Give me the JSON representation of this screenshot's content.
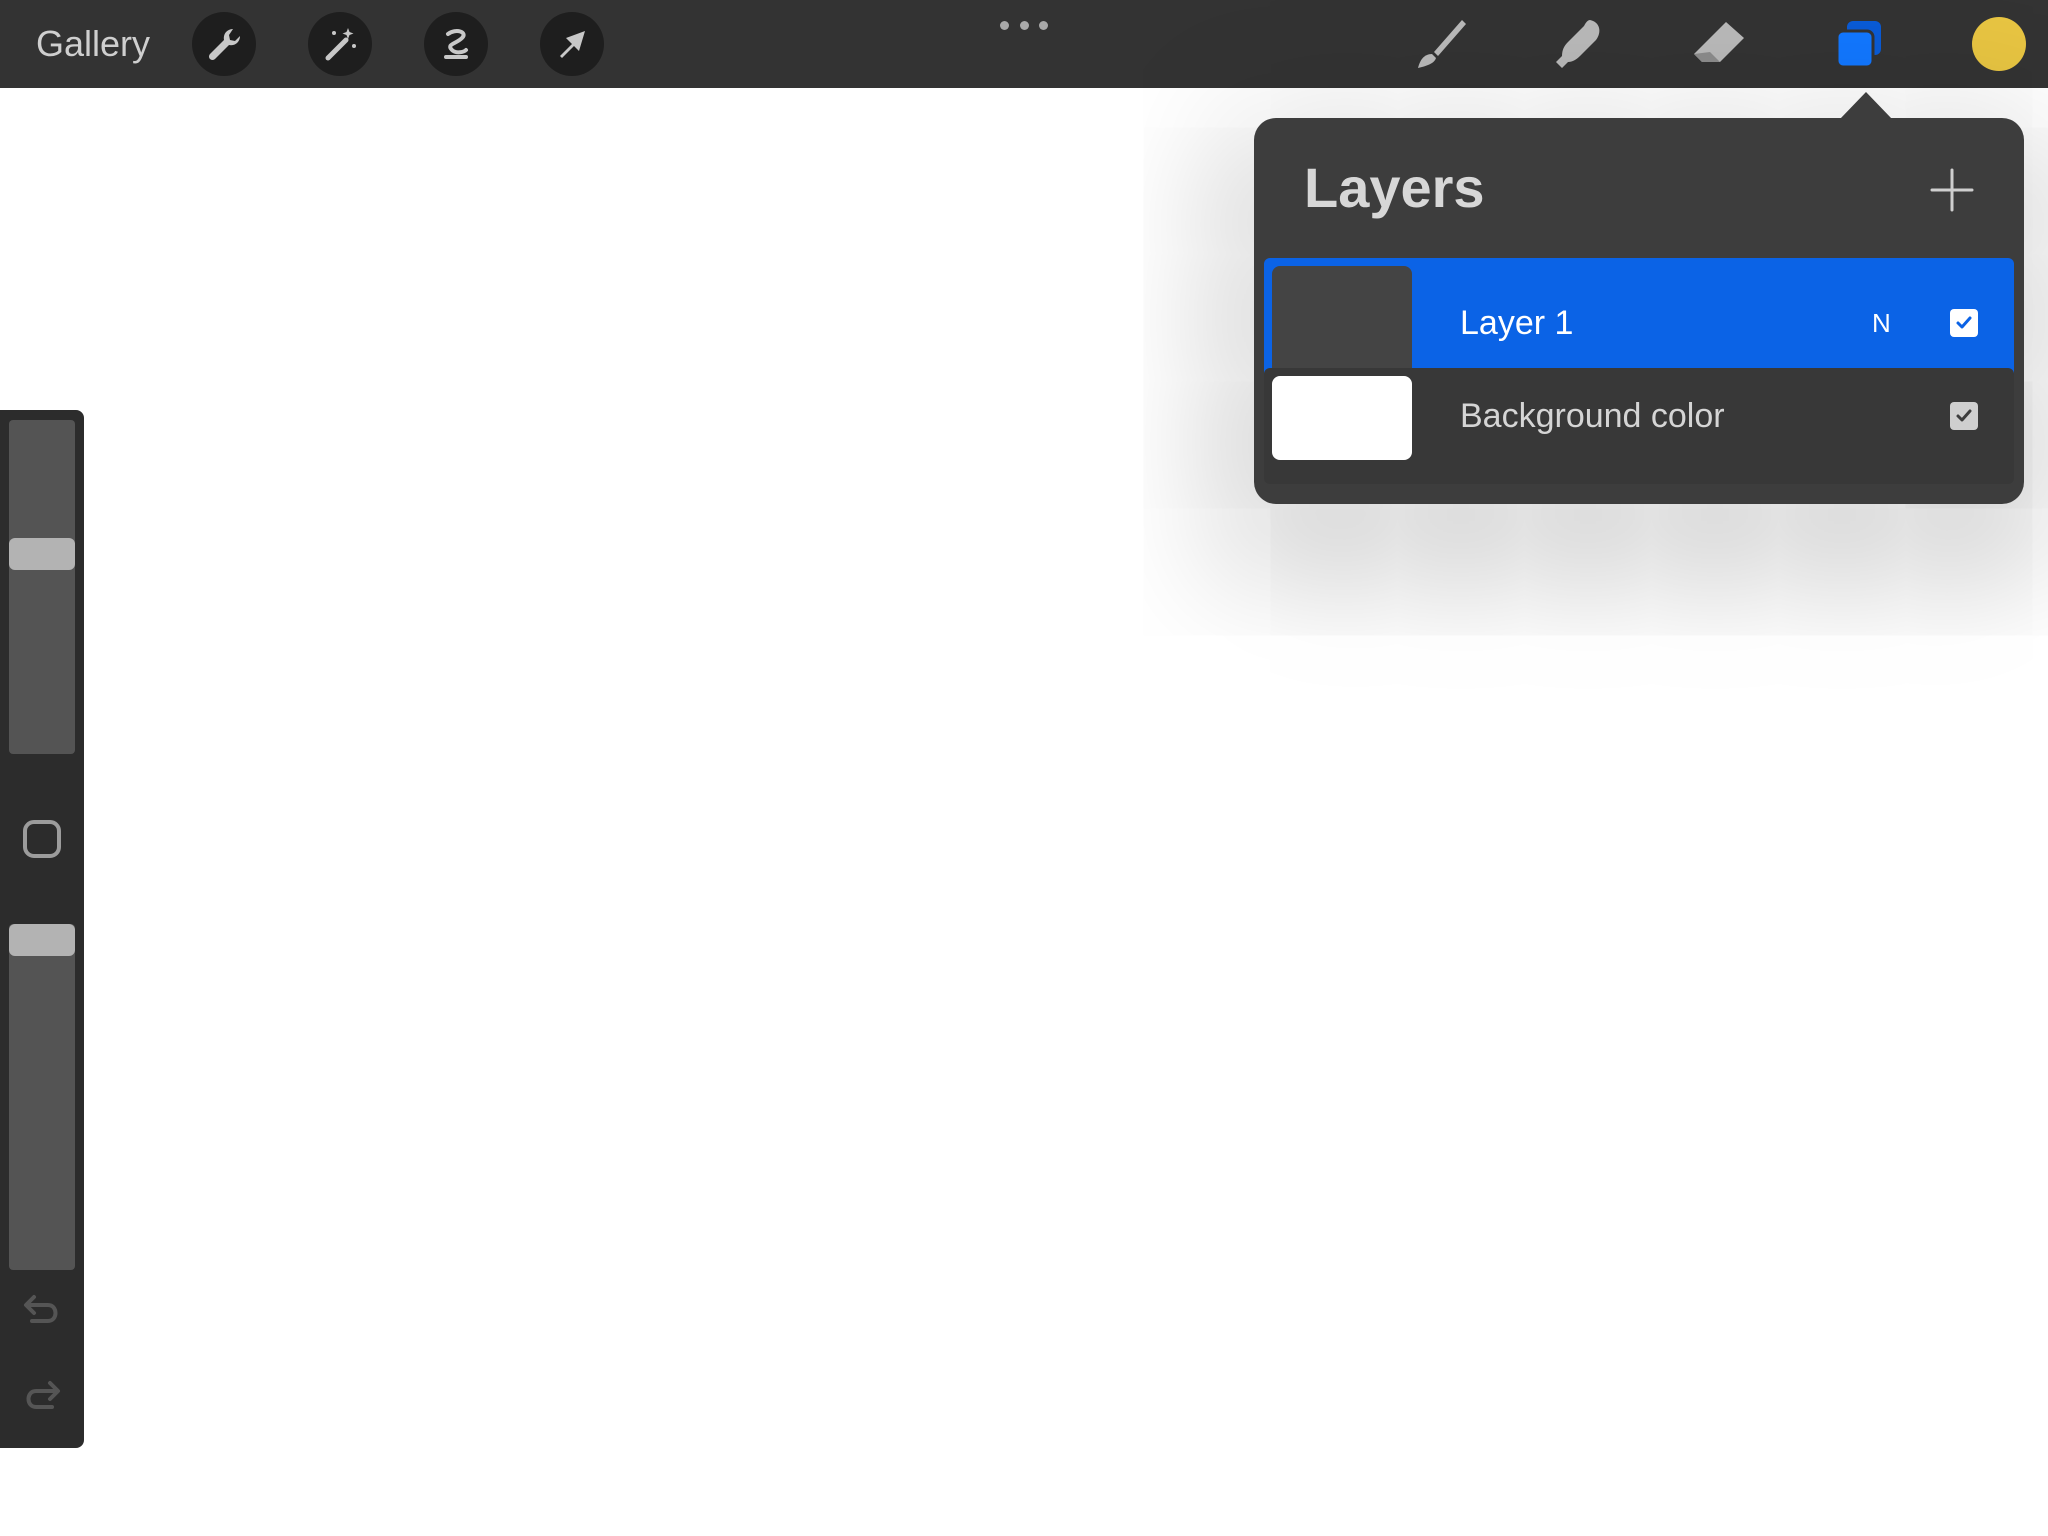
{
  "topbar": {
    "gallery_label": "Gallery",
    "left_tools": [
      {
        "name": "actions",
        "icon": "wrench-icon"
      },
      {
        "name": "adjustments",
        "icon": "magic-wand-icon"
      },
      {
        "name": "selection",
        "icon": "selection-s-icon"
      },
      {
        "name": "transform",
        "icon": "arrow-cursor-icon"
      }
    ],
    "right_tools": [
      {
        "name": "brush",
        "icon": "brush-icon"
      },
      {
        "name": "smudge",
        "icon": "smudge-finger-icon"
      },
      {
        "name": "eraser",
        "icon": "eraser-icon"
      },
      {
        "name": "layers",
        "icon": "layers-icon",
        "active": true
      }
    ],
    "current_color": "#e8c542"
  },
  "sidebar": {
    "tools": [
      "brush-size-slider",
      "modify-button",
      "opacity-slider",
      "undo-icon",
      "redo-icon"
    ]
  },
  "layers_panel": {
    "title": "Layers",
    "add_icon": "plus-icon",
    "layers": [
      {
        "name": "Layer 1",
        "blend_mode": "N",
        "visible": true,
        "selected": true,
        "thumbnail_color": "#444444"
      },
      {
        "name": "Background color",
        "blend_mode": "",
        "visible": true,
        "selected": false,
        "thumbnail_color": "#ffffff"
      }
    ]
  },
  "colors": {
    "accent_blue": "#0b63e6",
    "topbar_bg": "#333333",
    "panel_bg": "#3d3d3d"
  }
}
